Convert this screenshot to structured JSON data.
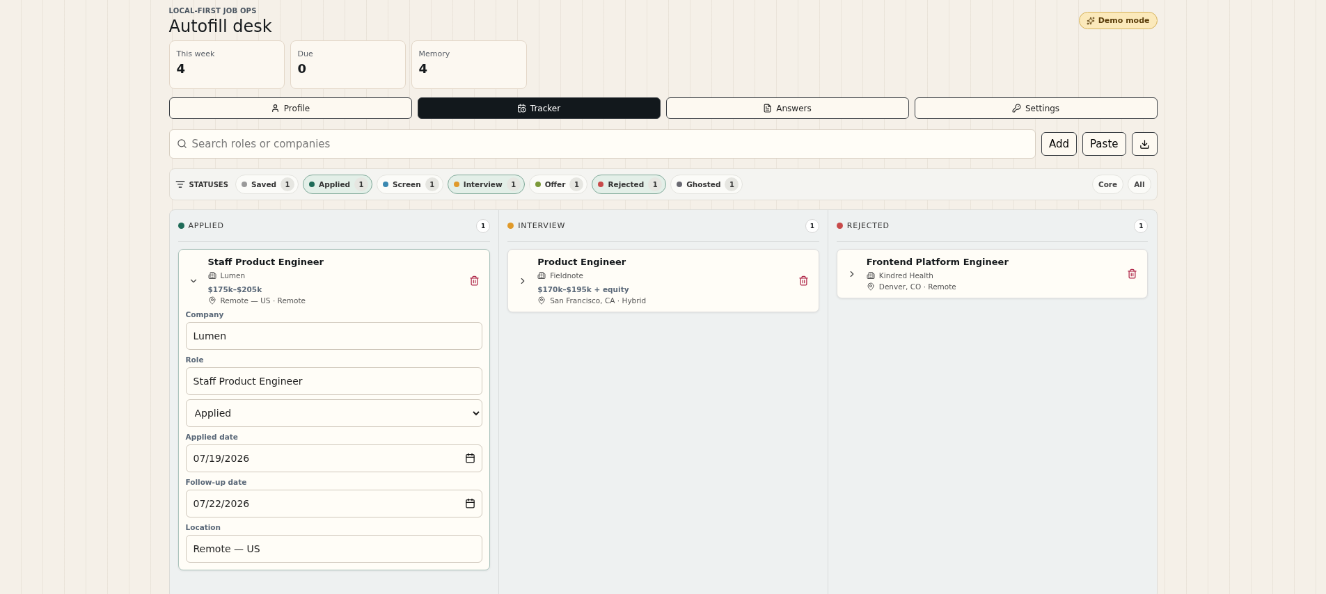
{
  "header": {
    "eyebrow": "LOCAL-FIRST JOB OPS",
    "title": "Autofill desk",
    "badge": "Demo mode"
  },
  "stats": [
    {
      "label": "This week",
      "value": "4"
    },
    {
      "label": "Due",
      "value": "0"
    },
    {
      "label": "Memory",
      "value": "4"
    }
  ],
  "tabs": [
    {
      "label": "Profile",
      "selected": false
    },
    {
      "label": "Tracker",
      "selected": true
    },
    {
      "label": "Answers",
      "selected": false
    },
    {
      "label": "Settings",
      "selected": false
    }
  ],
  "search": {
    "placeholder": "Search roles or companies"
  },
  "actions": [
    {
      "kind": "text",
      "label": "Add"
    },
    {
      "kind": "text",
      "label": "Paste"
    },
    {
      "kind": "download"
    }
  ],
  "status_filter": {
    "label": "STATUSES",
    "statuses": [
      {
        "label": "Saved",
        "count": "1",
        "color": "#9a9a9a",
        "selected": false
      },
      {
        "label": "Applied",
        "count": "1",
        "color": "#1e6b58",
        "selected": true
      },
      {
        "label": "Screen",
        "count": "1",
        "color": "#3a88b0",
        "selected": false
      },
      {
        "label": "Interview",
        "count": "1",
        "color": "#e09a2a",
        "selected": true
      },
      {
        "label": "Offer",
        "count": "1",
        "color": "#7c9a3a",
        "selected": false
      },
      {
        "label": "Rejected",
        "count": "1",
        "color": "#c84a4a",
        "selected": true
      },
      {
        "label": "Ghosted",
        "count": "1",
        "color": "#6a6a72",
        "selected": false
      }
    ],
    "presets": [
      "Core",
      "All"
    ]
  },
  "columns": [
    {
      "title": "APPLIED",
      "count": "1",
      "color": "#1e6b58",
      "cards": [
        {
          "title": "Staff Product Engineer",
          "company": "Lumen",
          "salary": "$175k–$205k",
          "location": "Remote — US · Remote",
          "expanded": true,
          "fields": [
            {
              "kind": "text",
              "label": "Company",
              "value": "Lumen"
            },
            {
              "kind": "text",
              "label": "Role",
              "value": "Staff Product Engineer"
            },
            {
              "kind": "select",
              "value": "Applied"
            },
            {
              "kind": "date",
              "label": "Applied date",
              "value": "07/19/2026"
            },
            {
              "kind": "date",
              "label": "Follow-up date",
              "value": "07/22/2026"
            },
            {
              "kind": "text",
              "label": "Location",
              "value": "Remote — US"
            }
          ]
        }
      ]
    },
    {
      "title": "INTERVIEW",
      "count": "1",
      "color": "#e09a2a",
      "cards": [
        {
          "title": "Product Engineer",
          "company": "Fieldnote",
          "salary": "$170k–$195k + equity",
          "location": "San Francisco, CA · Hybrid",
          "expanded": false
        }
      ]
    },
    {
      "title": "REJECTED",
      "count": "1",
      "color": "#c84a4a",
      "cards": [
        {
          "title": "Frontend Platform Engineer",
          "company": "Kindred Health",
          "location": "Denver, CO · Remote",
          "expanded": false
        }
      ]
    }
  ]
}
